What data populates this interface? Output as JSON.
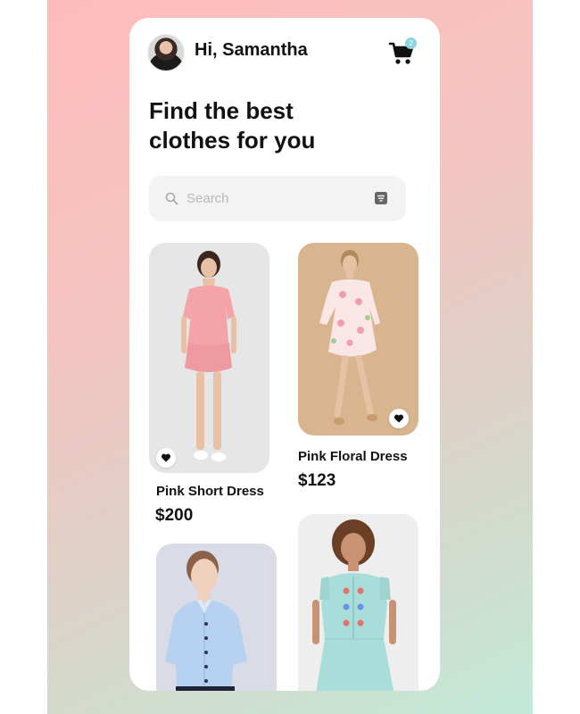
{
  "header": {
    "greeting": "Hi, Samantha",
    "avatar_icon": "user-avatar",
    "cart_icon": "shopping-cart-icon",
    "cart_count": "2"
  },
  "headline": {
    "line1": "Find the best",
    "line2": "clothes for you"
  },
  "search": {
    "placeholder": "Search",
    "value": "",
    "search_icon": "search-icon",
    "filter_icon": "filter-icon"
  },
  "products": [
    {
      "name": "Pink Short Dress",
      "price": "$200",
      "image_icon": "pink-short-dress-photo",
      "favorite": true
    },
    {
      "name": "Pink Floral Dress",
      "price": "$123",
      "image_icon": "pink-floral-dress-photo",
      "favorite": true
    },
    {
      "name": "",
      "price": "",
      "image_icon": "light-blue-shirt-photo"
    },
    {
      "name": "",
      "price": "",
      "image_icon": "mint-embroidered-dress-photo"
    }
  ],
  "colors": {
    "background_gradient": [
      "#fdbcbc",
      "#c2e9d8"
    ],
    "card_bg": "#ffffff",
    "search_bg": "#f3f3f3",
    "badge": "#8fd3dc",
    "text": "#111111"
  }
}
